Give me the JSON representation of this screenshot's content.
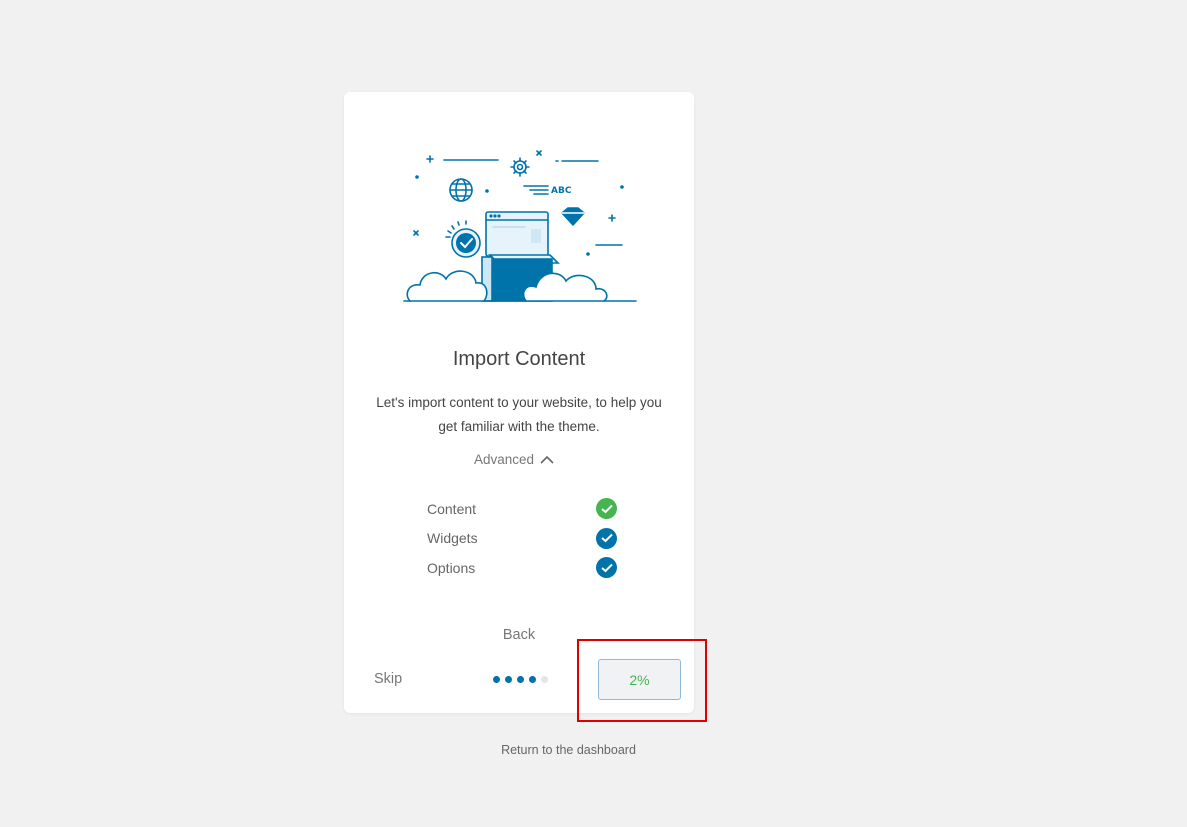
{
  "card": {
    "title": "Import Content",
    "description": "Let's import content to your website, to help you get familiar with the theme.",
    "advanced_label": "Advanced",
    "options": [
      {
        "label": "Content",
        "state": "done",
        "color": "#46b450"
      },
      {
        "label": "Widgets",
        "state": "checked",
        "color": "#0073aa"
      },
      {
        "label": "Options",
        "state": "checked",
        "color": "#0073aa"
      }
    ],
    "back_label": "Back",
    "skip_label": "Skip",
    "progress": {
      "text": "2%",
      "fraction": 0.02
    },
    "steps": {
      "total": 5,
      "active": 4
    }
  },
  "footer": {
    "return_label": "Return to the dashboard"
  },
  "colors": {
    "accent": "#0073aa",
    "success": "#46b450",
    "highlight": "#e00000",
    "dot_inactive": "#e4e4e4"
  }
}
